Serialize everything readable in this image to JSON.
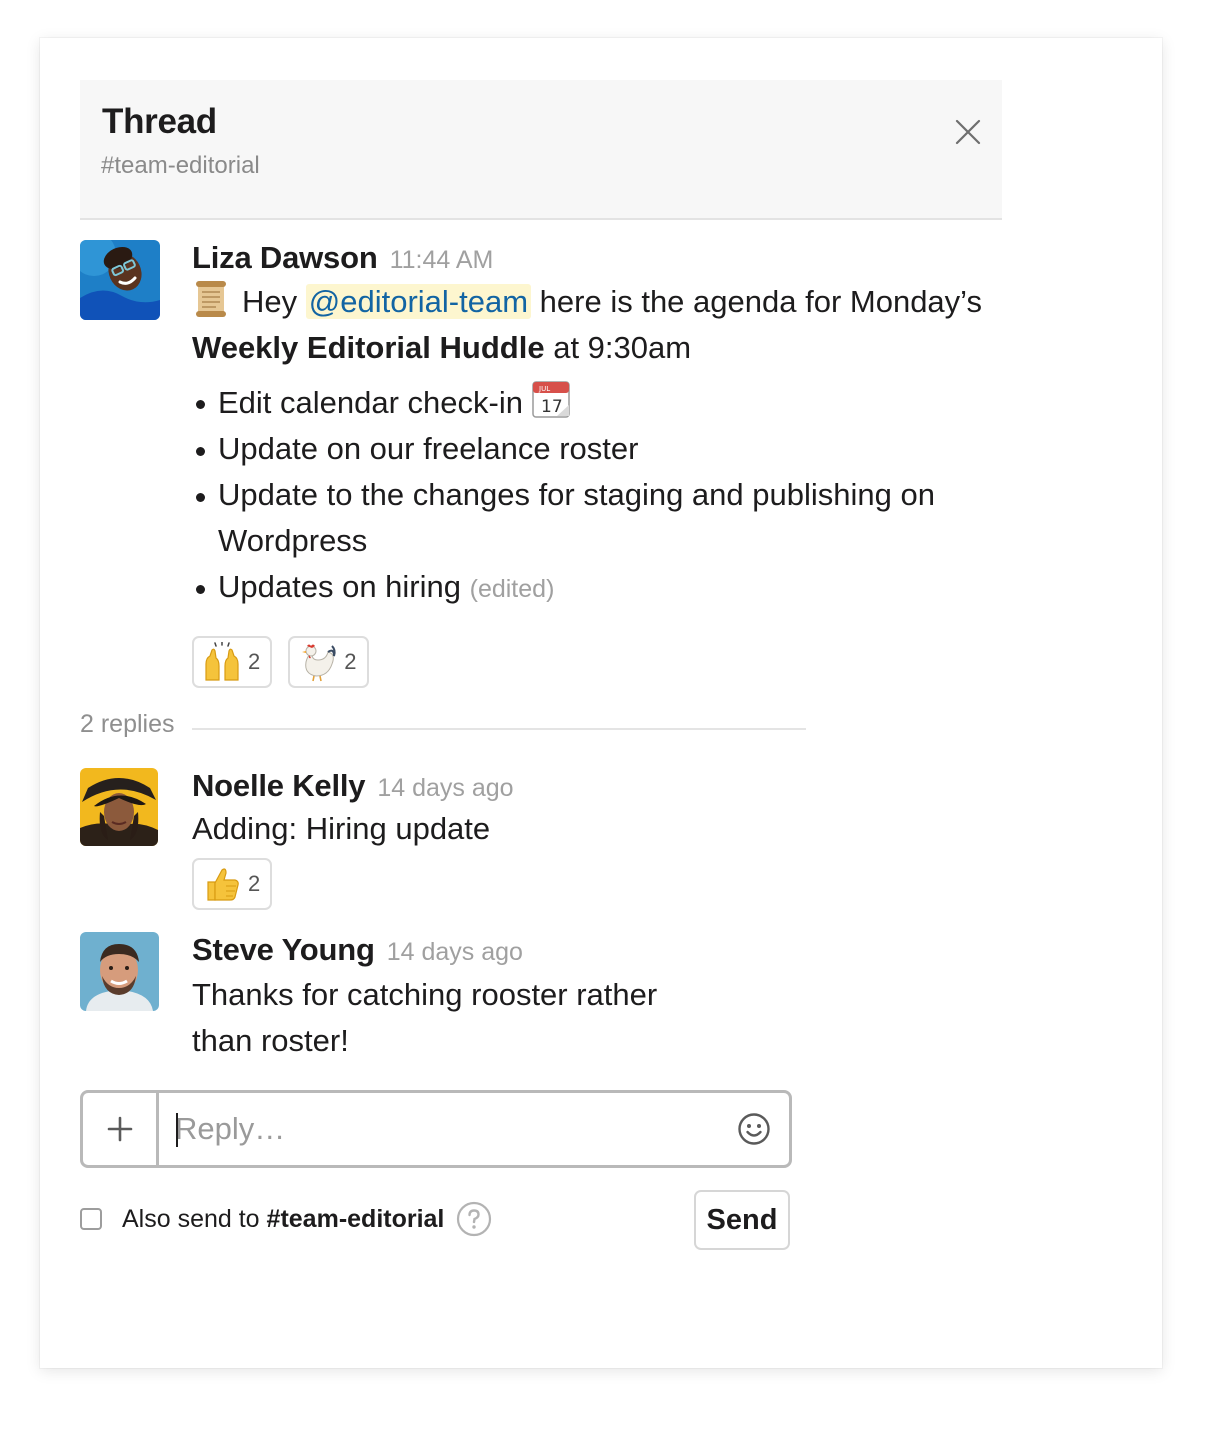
{
  "header": {
    "title": "Thread",
    "channel": "#team-editorial"
  },
  "parent_message": {
    "sender": "Liza Dawson",
    "time": "11:44 AM",
    "intro_emoji": "scroll-emoji",
    "text_before_mention": "Hey",
    "mention": "@editorial-team",
    "text_after_mention": "here is the agenda for Monday’s",
    "bold_text": "Weekly Editorial Huddle",
    "text_after_bold": "at 9:30am",
    "agenda": [
      "Edit calendar check-in",
      "Update on our freelance roster",
      "Update to the changes for staging and publishing on Wordpress",
      "Updates on hiring"
    ],
    "calendar_emoji_label": "JUL",
    "calendar_emoji_day": "17",
    "edited_label": "(edited)",
    "reactions": [
      {
        "emoji": "raised-hands-emoji",
        "count": "2"
      },
      {
        "emoji": "rooster-emoji",
        "count": "2"
      }
    ]
  },
  "replies_label": "2 replies",
  "replies": [
    {
      "sender": "Noelle Kelly",
      "time": "14 days ago",
      "text": "Adding: Hiring update",
      "reactions": [
        {
          "emoji": "thumbs-up-emoji",
          "count": "2"
        }
      ]
    },
    {
      "sender": "Steve Young",
      "time": "14 days ago",
      "text_line1": "Thanks for catching rooster rather",
      "text_line2": "than roster!"
    }
  ],
  "composer": {
    "placeholder": "Reply…",
    "value": "",
    "attach_icon": "plus-icon",
    "emoji_icon": "smiley-icon"
  },
  "also_send": {
    "label": "Also send to",
    "channel": "#team-editorial",
    "checked": false,
    "help_icon": "question-icon"
  },
  "send_label": "Send",
  "colors": {
    "mention_bg": "#fdf6cf",
    "mention_text": "#1264a3",
    "header_bg": "#f7f7f7",
    "muted_text": "#a0a0a0"
  }
}
